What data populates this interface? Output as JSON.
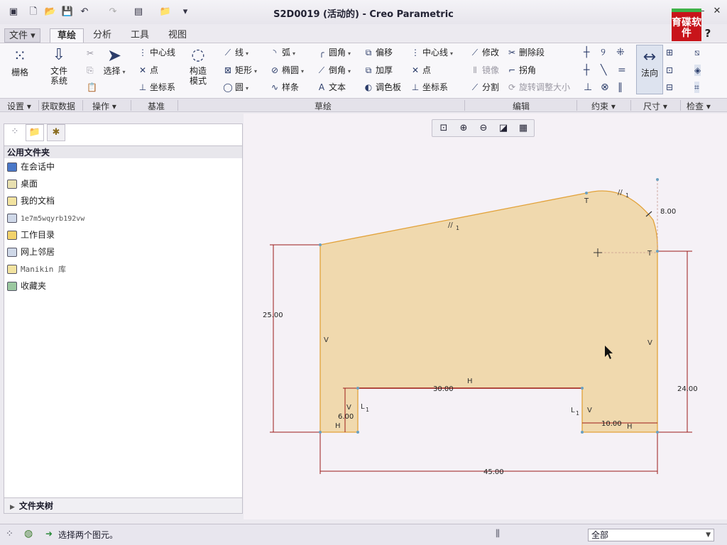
{
  "app": {
    "title": "S2D0019 (活动的) - Creo Parametric"
  },
  "logo": {
    "text": "育碟软件"
  },
  "tabs": [
    {
      "label": "文件 ▾"
    },
    {
      "label": "草绘"
    },
    {
      "label": "分析"
    },
    {
      "label": "工具"
    },
    {
      "label": "视图"
    }
  ],
  "ribbon": {
    "settings": {
      "grid": "栅格"
    },
    "data": {
      "file_system": [
        "文件",
        "系统"
      ]
    },
    "operations": {
      "cut": "",
      "select": "选择"
    },
    "datum": {
      "centerline": "中心线",
      "point": "点",
      "coord": "坐标系"
    },
    "construction": [
      "构造",
      "模式"
    ],
    "sketch": {
      "line": "线",
      "rect": "矩形",
      "circle": "圆",
      "arc": "弧",
      "ellipse": "椭圆",
      "spline": "样条",
      "fillet": "圆角",
      "chamfer": "倒角",
      "text": "文本",
      "offset": "偏移",
      "thicken": "加厚",
      "palette": "调色板",
      "centerline": "中心线",
      "point": "点",
      "coord": "坐标系"
    },
    "edit": {
      "modify": "修改",
      "mirror": "镜像",
      "divide": "分割",
      "delete_segment": "删除段",
      "corner": "拐角",
      "rotate_resize": "旋转调整大小"
    },
    "normal": "法向",
    "groups": [
      "设置 ▾",
      "获取数据",
      "操作 ▾",
      "基准",
      "草绘",
      "编辑",
      "约束 ▾",
      "尺寸 ▾",
      "检查 ▾"
    ]
  },
  "folders": {
    "header": "公用文件夹",
    "items": [
      {
        "label": "在会话中",
        "icon": "monitor-icon"
      },
      {
        "label": "桌面",
        "icon": "desktop-icon"
      },
      {
        "label": "我的文档",
        "icon": "documents-icon"
      },
      {
        "label": "1e7m5wqyrb192vw",
        "icon": "computer-icon"
      },
      {
        "label": "工作目录",
        "icon": "working-dir-icon"
      },
      {
        "label": "网上邻居",
        "icon": "network-icon"
      },
      {
        "label": "Manikin 库",
        "icon": "manikin-icon"
      },
      {
        "label": "收藏夹",
        "icon": "favorites-icon"
      }
    ],
    "tree": "文件夹树"
  },
  "sketch": {
    "dims": {
      "height_left": "25.00",
      "radius": "8.00",
      "height_right": "24.00",
      "slot_width": "30.00",
      "slot_depth": "6.00",
      "foot_width": "10.00",
      "total_width": "45.00"
    },
    "constraints": {
      "h": "H",
      "v": "V",
      "t": "T",
      "parallel": "//",
      "sub1": "1",
      "l": "L"
    },
    "colors": {
      "fill": "#f0d9ae",
      "edge": "#e2a23a",
      "dim": "#9b1a1a"
    }
  },
  "status": {
    "message": "选择两个图元。",
    "filter": "全部"
  }
}
